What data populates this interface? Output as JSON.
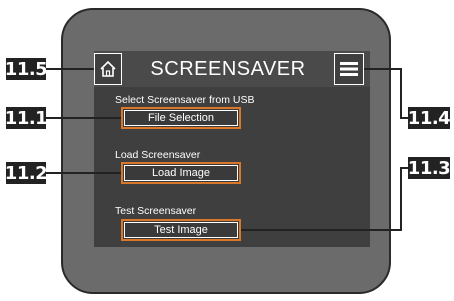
{
  "screen": {
    "title": "SCREENSAVER"
  },
  "sections": [
    {
      "caption": "Select Screensaver from USB",
      "button_label": "File Selection"
    },
    {
      "caption": "Load Screensaver",
      "button_label": "Load Image"
    },
    {
      "caption": "Test Screensaver",
      "button_label": "Test Image"
    }
  ],
  "callouts": {
    "home": "11.5",
    "file_selection": "11.1",
    "load_image": "11.2",
    "test_image": "11.3",
    "menu": "11.4"
  },
  "icons": {
    "home": "home-icon",
    "menu": "menu-icon"
  },
  "colors": {
    "button_border": "#d9772a",
    "screen_bg": "#3f3f3f",
    "device_bezel": "#6b6b6b"
  }
}
